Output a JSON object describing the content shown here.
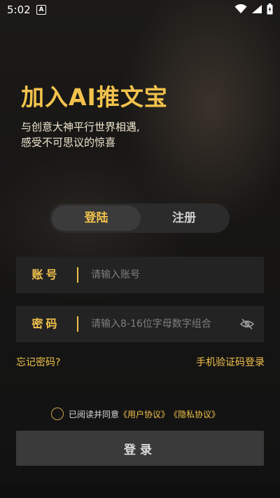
{
  "status_bar": {
    "time": "5:02",
    "app_badge": "A",
    "icons": [
      "wifi-icon",
      "signal-icon",
      "battery-charging-icon"
    ]
  },
  "hero": {
    "title": "加入AI推文宝",
    "subtitle_line1": "与创意大神平行世界相遇,",
    "subtitle_line2": "感受不可思议的惊喜"
  },
  "tabs": [
    {
      "label": "登陆",
      "active": true
    },
    {
      "label": "注册",
      "active": false
    }
  ],
  "form": {
    "account": {
      "label": "账号",
      "placeholder": "请输入账号",
      "value": ""
    },
    "password": {
      "label": "密码",
      "placeholder": "请输入8-16位字母数字组合",
      "value": "",
      "toggle_icon": "eye-off-icon"
    }
  },
  "links": {
    "forgot": "忘记密码?",
    "sms_login": "手机验证码登录"
  },
  "agreement": {
    "checked": false,
    "prefix": "已阅读并同意",
    "user_agreement": "《用户协议》",
    "privacy_agreement": "《隐私协议》"
  },
  "login_button": "登录",
  "colors": {
    "accent": "#f2c24c",
    "background": "#161514",
    "field_bg": "#232323",
    "button_bg": "#3a3a3a"
  }
}
